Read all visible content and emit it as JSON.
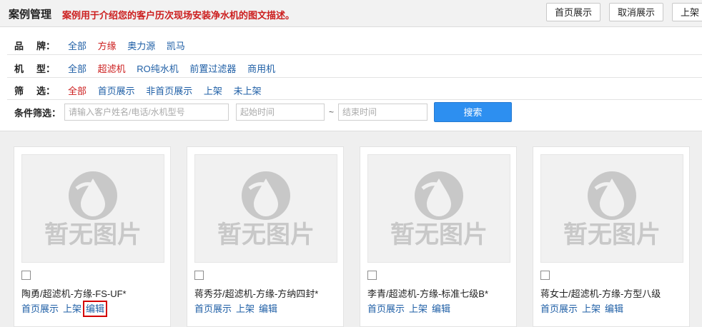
{
  "header": {
    "title": "案例管理",
    "description": "案例用于介绍您的客户历次现场安装净水机的图文描述。",
    "buttons": [
      "首页展示",
      "取消展示",
      "上架"
    ]
  },
  "filters": {
    "brand": {
      "label_chars": [
        "品",
        "牌："
      ],
      "options": [
        "全部",
        "方缘",
        "奥力源",
        "凯马"
      ],
      "active": 1
    },
    "model": {
      "label_chars": [
        "机",
        "型："
      ],
      "options": [
        "全部",
        "超滤机",
        "RO纯水机",
        "前置过滤器",
        "商用机"
      ],
      "active": 1
    },
    "screen": {
      "label_chars": [
        "筛",
        "选："
      ],
      "options": [
        "全部",
        "首页展示",
        "非首页展示",
        "上架",
        "未上架"
      ],
      "active": 0
    },
    "condition": {
      "label": "条件筛选：",
      "keyword_placeholder": "请输入客户姓名/电话/水机型号",
      "start_placeholder": "起始时间",
      "separator": "~",
      "end_placeholder": "结束时间",
      "search_label": "搜索"
    }
  },
  "placeholder_image_text": "暂无图片",
  "cards": [
    {
      "title": "陶勇/超滤机-方缘-FS-UF*",
      "links": [
        "首页展示",
        "上架",
        "编辑"
      ]
    },
    {
      "title": "蒋秀芬/超滤机-方缘-方纳四封*",
      "links": [
        "首页展示",
        "上架",
        "编辑"
      ]
    },
    {
      "title": "李青/超滤机-方缘-标准七级B*",
      "links": [
        "首页展示",
        "上架",
        "编辑"
      ]
    },
    {
      "title": "蒋女士/超滤机-方缘-方型八级",
      "links": [
        "首页展示",
        "上架",
        "编辑"
      ]
    }
  ],
  "colors": {
    "accent_red": "#cc1e1e",
    "link_blue": "#1f5fa6",
    "button_blue": "#2d8ff0",
    "highlight": "#d40000"
  }
}
